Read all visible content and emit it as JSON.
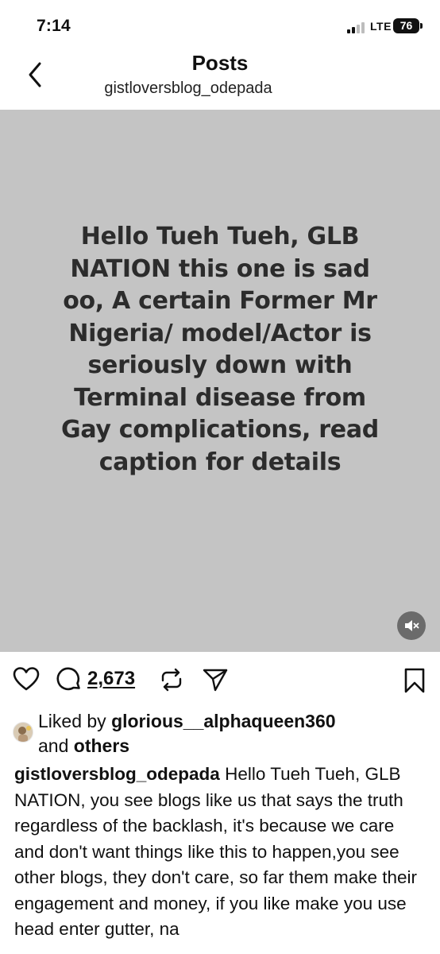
{
  "status_bar": {
    "time": "7:14",
    "network": "LTE",
    "battery": "76"
  },
  "header": {
    "title": "Posts",
    "username": "gistloversblog_odepada"
  },
  "post": {
    "image_text": "Hello Tueh Tueh, GLB NATION this one is sad oo, A certain Former Mr Nigeria/ model/Actor is seriously down with Terminal disease from Gay complications, read caption for details",
    "media_background": "#c4c4c4"
  },
  "actions": {
    "comment_count": "2,673",
    "icons": [
      "heart-icon",
      "comment-icon",
      "repost-icon",
      "share-icon",
      "bookmark-icon",
      "mute-icon"
    ]
  },
  "likes": {
    "prefix": "Liked by",
    "user": "glorious__alphaqueen360",
    "conjunction": "and",
    "others": "others"
  },
  "caption": {
    "username": "gistloversblog_odepada",
    "text": "Hello Tueh Tueh, GLB NATION, you see blogs like us that says the truth regardless of the backlash, it's because we care and don't want things like this to happen,you see other blogs, they don't care, so far them make their engagement and money, if you like make you use head enter gutter, na"
  }
}
